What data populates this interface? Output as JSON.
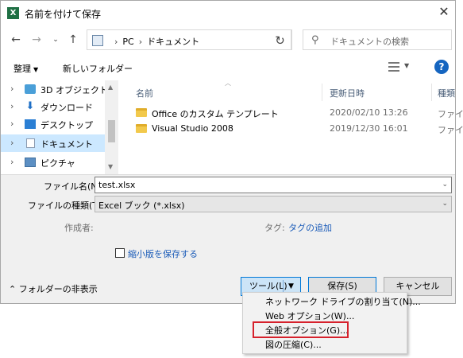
{
  "window": {
    "title": "名前を付けて保存",
    "app_icon_letter": "X",
    "app_color": "#1f7044"
  },
  "nav": {
    "address_segments": [
      "PC",
      "ドキュメント"
    ],
    "search_placeholder": "ドキュメントの検索"
  },
  "toolbar": {
    "organize_label": "整理",
    "new_folder_label": "新しいフォルダー",
    "help_label": "?"
  },
  "sidebar": {
    "items": [
      {
        "label": "3D オブジェクト",
        "icon": "cube-icon"
      },
      {
        "label": "ダウンロード",
        "icon": "download-icon"
      },
      {
        "label": "デスクトップ",
        "icon": "desktop-icon"
      },
      {
        "label": "ドキュメント",
        "icon": "documents-icon",
        "selected": true
      },
      {
        "label": "ピクチャ",
        "icon": "pictures-icon"
      }
    ]
  },
  "files": {
    "columns": [
      "名前",
      "更新日時",
      "種類"
    ],
    "rows": [
      {
        "name": "Office のカスタム テンプレート",
        "date": "2020/02/10 13:26",
        "type": "ファイル"
      },
      {
        "name": "Visual Studio 2008",
        "date": "2019/12/30 16:01",
        "type": "ファイル"
      }
    ]
  },
  "form": {
    "filename_label": "ファイル名(N):",
    "filename_value": "test.xlsx",
    "filetype_label": "ファイルの種類(T):",
    "filetype_value": "Excel ブック (*.xlsx)",
    "author_label": "作成者:",
    "tags_label": "タグ:",
    "tags_link": "タグの追加",
    "thumbnail_label": "縮小版を保存する",
    "hide_folders_label": "フォルダーの非表示"
  },
  "buttons": {
    "tools_label": "ツール(L)",
    "save_label": "保存(S)",
    "cancel_label": "キャンセル"
  },
  "tools_menu": {
    "items": [
      "ネットワーク ドライブの割り当て(N)...",
      "Web オプション(W)...",
      "全般オプション(G)...",
      "図の圧縮(C)..."
    ],
    "highlight_color": "#d6212c"
  }
}
